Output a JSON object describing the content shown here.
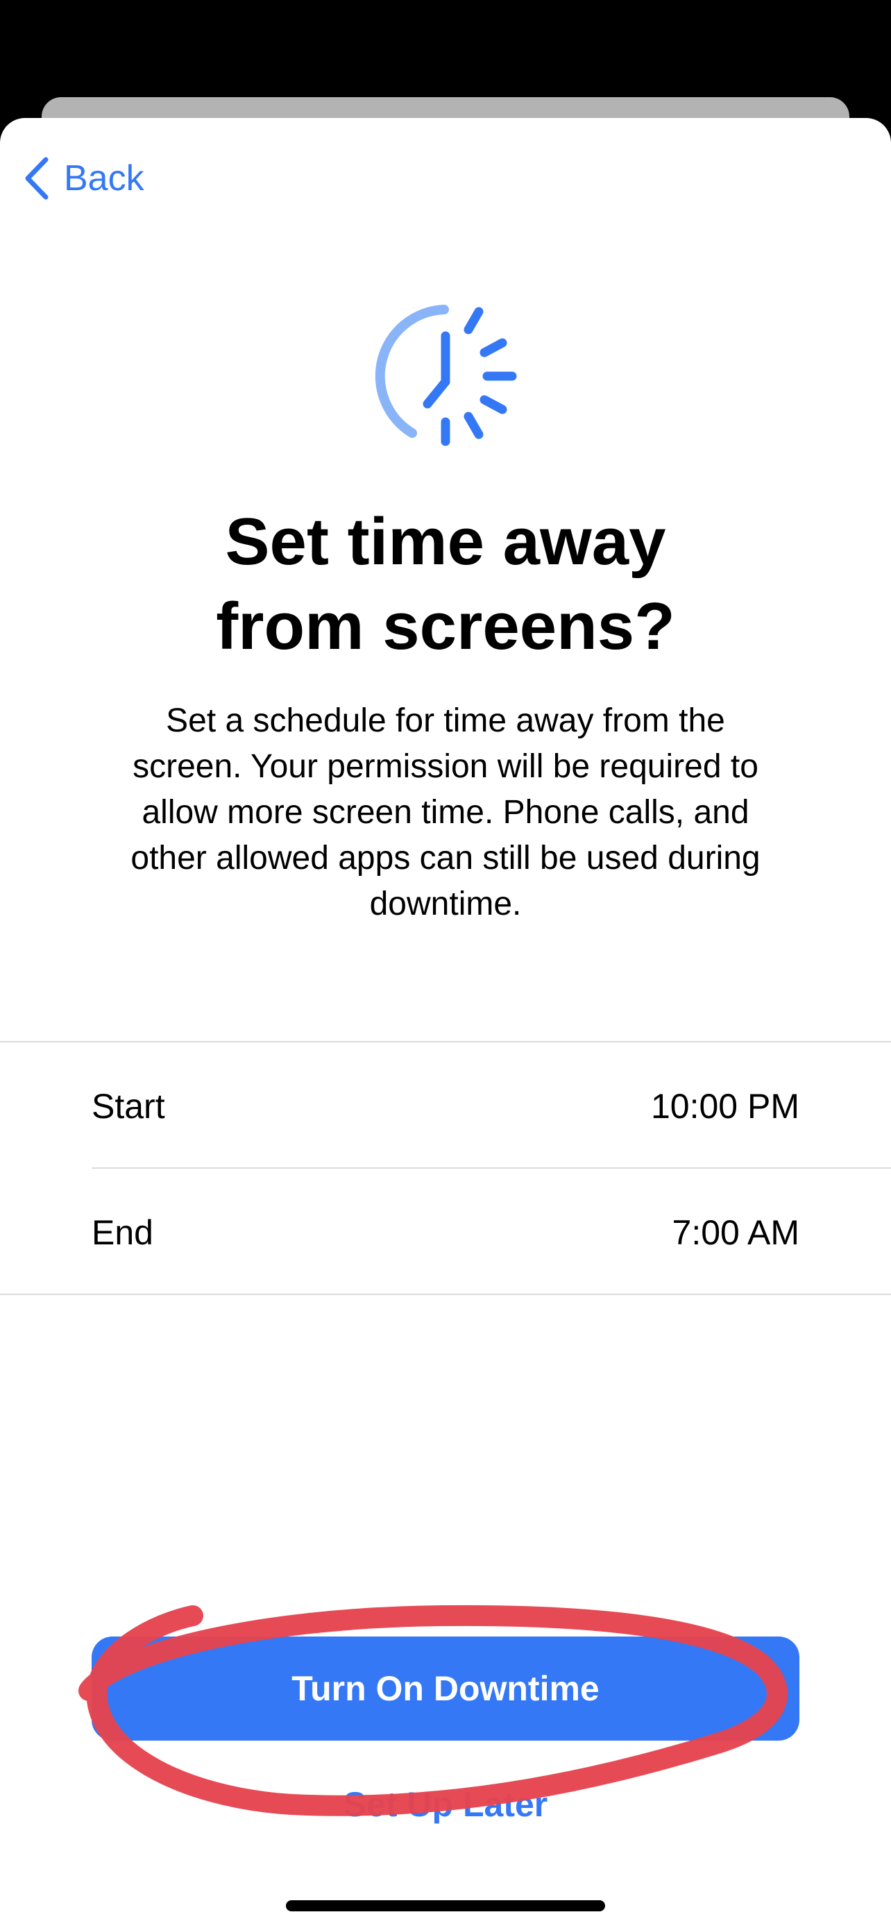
{
  "nav": {
    "back_label": "Back"
  },
  "header": {
    "icon": "downtime-clock-icon",
    "title": "Set time away\nfrom screens?",
    "description": "Set a schedule for time away from the\nscreen. Your permission will be required to\nallow more screen time. Phone calls, and\nother allowed apps can still be used during\ndowntime."
  },
  "schedule": {
    "rows": [
      {
        "label": "Start",
        "value": "10:00 PM"
      },
      {
        "label": "End",
        "value": "7:00 AM"
      }
    ]
  },
  "actions": {
    "primary_label": "Turn On Downtime",
    "secondary_label": "Set Up Later"
  },
  "colors": {
    "accent": "#3478f6",
    "accent_light": "#8ab4f8",
    "annotation": "#e5444f",
    "background": "#ffffff"
  }
}
